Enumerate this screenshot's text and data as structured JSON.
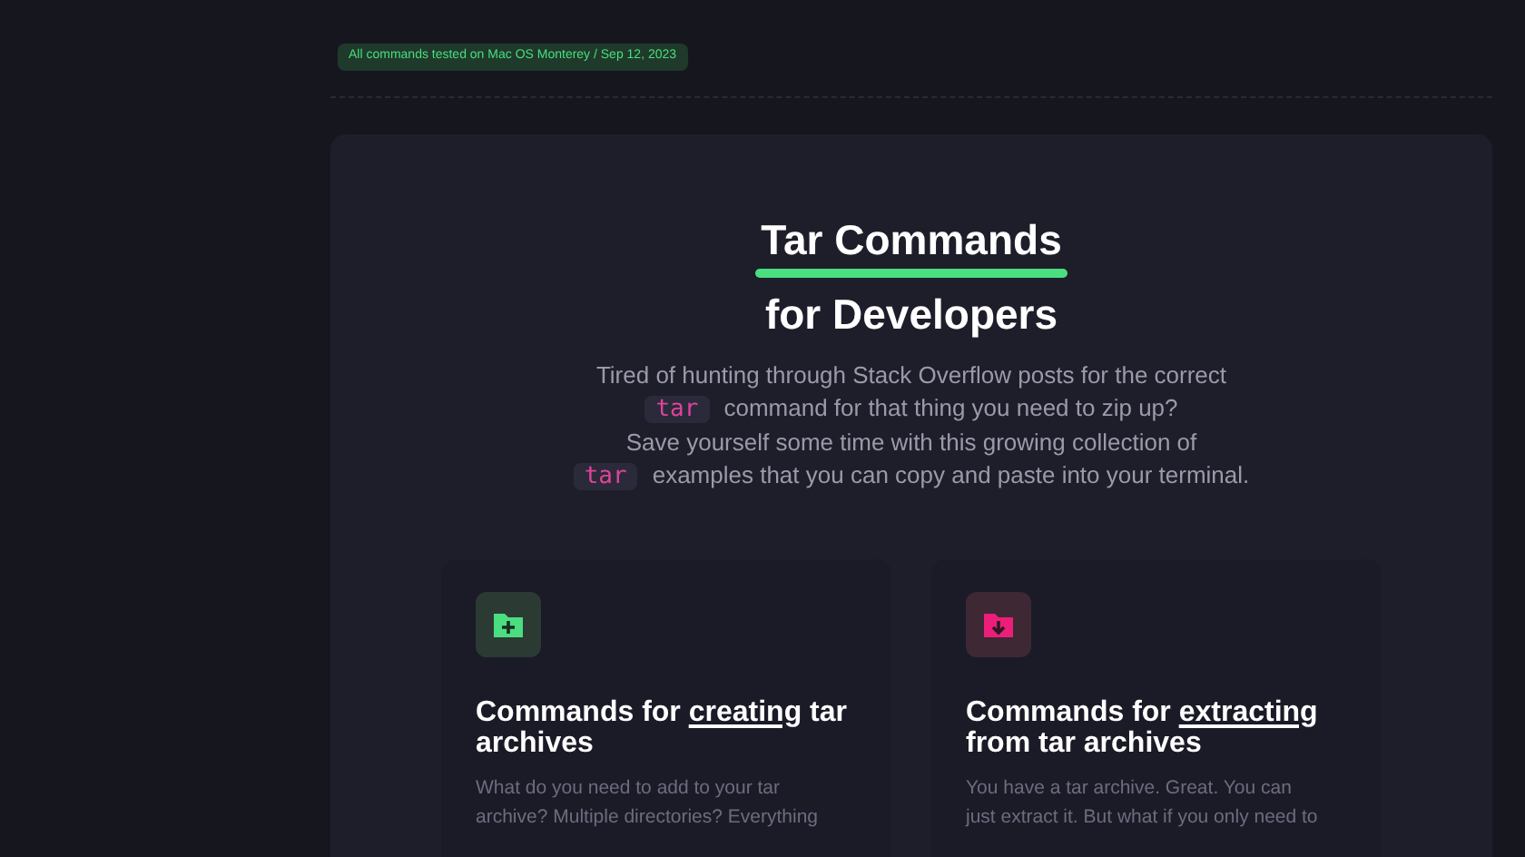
{
  "badge": "All commands tested on Mac OS Monterey / Sep 12, 2023",
  "hero": {
    "title": "Tar Commands",
    "subtitle": "for Developers",
    "intro": [
      [
        {
          "kind": "text",
          "text": "Tired of hunting through Stack Overflow posts for the correct"
        }
      ],
      [
        {
          "kind": "code",
          "text": "tar"
        },
        {
          "kind": "text",
          "text": "command for that thing you need to zip up?"
        }
      ],
      [
        {
          "kind": "text",
          "text": "Save yourself some time with this growing collection of"
        }
      ],
      [
        {
          "kind": "code",
          "text": "tar"
        },
        {
          "kind": "text",
          "text": "examples that you can copy and paste into your terminal."
        }
      ]
    ]
  },
  "cards": [
    {
      "kind": "create",
      "color": "#4ade80",
      "title": [
        {
          "kind": "text",
          "text": "Commands for "
        },
        {
          "kind": "underline",
          "text": "creating"
        },
        {
          "kind": "text",
          "text": " tar archives"
        }
      ],
      "text_lines": [
        "What do you need to add to your tar",
        "archive? Multiple directories? Everything"
      ]
    },
    {
      "kind": "extract",
      "color": "#ec1e79",
      "title": [
        {
          "kind": "text",
          "text": "Commands for "
        },
        {
          "kind": "underline",
          "text": "extracting"
        },
        {
          "kind": "text",
          "text": " from tar archives"
        }
      ],
      "text_lines": [
        "You have a tar archive. Great. You can",
        "just extract it. But what if you only need to"
      ]
    }
  ]
}
